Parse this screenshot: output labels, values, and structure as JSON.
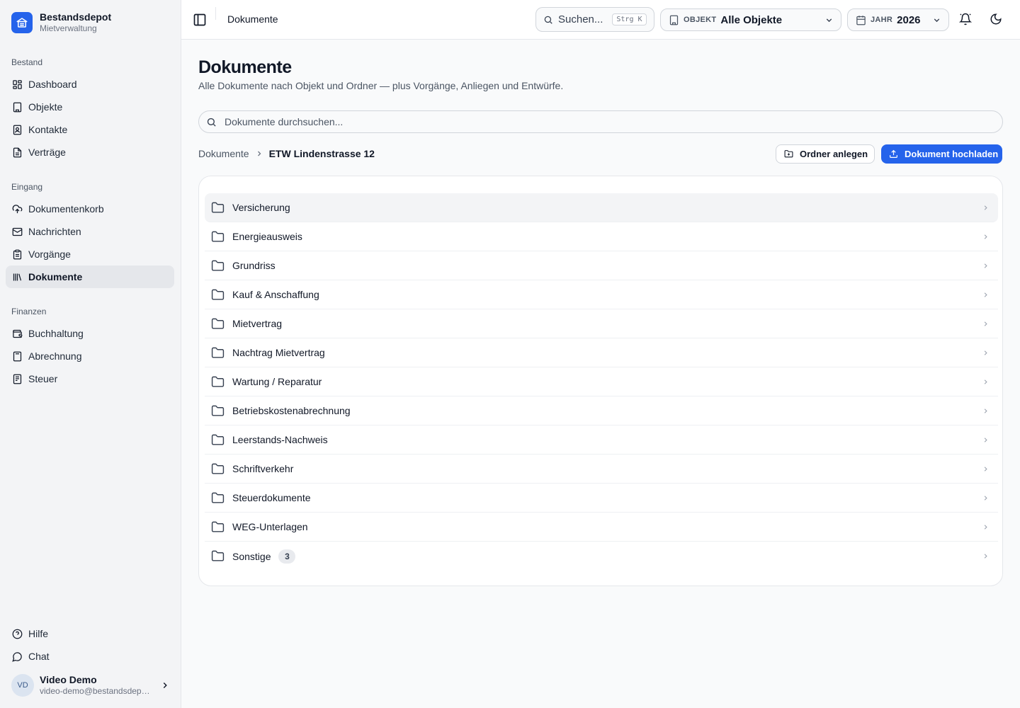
{
  "brand": {
    "title": "Bestandsdepot",
    "subtitle": "Mietverwaltung"
  },
  "nav": {
    "groups": [
      {
        "label": "Bestand",
        "items": [
          {
            "label": "Dashboard",
            "icon": "grid-icon"
          },
          {
            "label": "Objekte",
            "icon": "building-icon"
          },
          {
            "label": "Kontakte",
            "icon": "contact-book-icon"
          },
          {
            "label": "Verträge",
            "icon": "document-icon"
          }
        ]
      },
      {
        "label": "Eingang",
        "items": [
          {
            "label": "Dokumentenkorb",
            "icon": "cloud-upload-icon"
          },
          {
            "label": "Nachrichten",
            "icon": "mail-icon"
          },
          {
            "label": "Vorgänge",
            "icon": "clipboard-icon"
          },
          {
            "label": "Dokumente",
            "icon": "library-icon",
            "active": true
          }
        ]
      },
      {
        "label": "Finanzen",
        "items": [
          {
            "label": "Buchhaltung",
            "icon": "wallet-icon"
          },
          {
            "label": "Abrechnung",
            "icon": "calculator-icon"
          },
          {
            "label": "Steuer",
            "icon": "receipt-icon"
          }
        ]
      }
    ],
    "footer": [
      {
        "label": "Hilfe",
        "icon": "help-circle-icon"
      },
      {
        "label": "Chat",
        "icon": "chat-bubble-icon"
      }
    ]
  },
  "user": {
    "initials": "VD",
    "name": "Video Demo",
    "email": "video-demo@bestandsdepot.de"
  },
  "header": {
    "title": "Dokumente",
    "search_label": "Suchen...",
    "search_shortcut": "Strg K",
    "object_filter": {
      "label": "OBJEKT",
      "value": "Alle Objekte"
    },
    "year_filter": {
      "label": "JAHR",
      "value": "2026"
    }
  },
  "page": {
    "title": "Dokumente",
    "subtitle": "Alle Dokumente nach Objekt und Ordner — plus Vorgänge, Anliegen und Entwürfe.",
    "search_placeholder": "Dokumente durchsuchen...",
    "breadcrumb": {
      "root": "Dokumente",
      "current": "ETW Lindenstrasse 12"
    },
    "actions": {
      "new_folder": "Ordner anlegen",
      "upload": "Dokument hochladen"
    }
  },
  "folders": [
    {
      "name": "Versicherung",
      "count": null
    },
    {
      "name": "Energieausweis",
      "count": null
    },
    {
      "name": "Grundriss",
      "count": null
    },
    {
      "name": "Kauf & Anschaffung",
      "count": null
    },
    {
      "name": "Mietvertrag",
      "count": null
    },
    {
      "name": "Nachtrag Mietvertrag",
      "count": null
    },
    {
      "name": "Wartung / Reparatur",
      "count": null
    },
    {
      "name": "Betriebskostenabrechnung",
      "count": null
    },
    {
      "name": "Leerstands-Nachweis",
      "count": null
    },
    {
      "name": "Schriftverkehr",
      "count": null
    },
    {
      "name": "Steuerdokumente",
      "count": null
    },
    {
      "name": "WEG-Unterlagen",
      "count": null
    },
    {
      "name": "Sonstige",
      "count": "3"
    }
  ],
  "colors": {
    "accent": "#2563eb",
    "sidebar_bg": "#f3f4f6",
    "active_item": "#e5e7eb"
  }
}
